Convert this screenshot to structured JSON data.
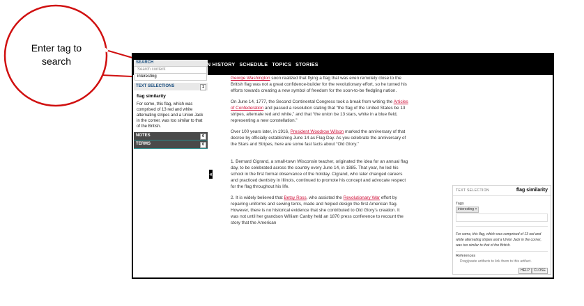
{
  "callout": {
    "text": "Enter tag to search"
  },
  "nav": {
    "items": [
      "N HISTORY",
      "SCHEDULE",
      "TOPICS",
      "STORIES"
    ]
  },
  "sidebar": {
    "search_header": "SEARCH",
    "search_placeholder": "Search content",
    "tag_value": "interesting",
    "text_selections_label": "TEXT SELECTIONS",
    "text_selections_count": "1",
    "selection": {
      "title": "flag similarity",
      "text": "For some, this flag, which was comprised of 13 red and white alternating stripes and a Union Jack in the corner, was too similar to that of the British."
    },
    "notes_label": "NOTES",
    "notes_count": "0",
    "terms_label": "TERMS",
    "terms_count": "0"
  },
  "collapse_icon": "«",
  "article": {
    "p1_link": "George Washington",
    "p1_rest": " soon realized that flying a flag that was even remotely close to the British flag was not a great confidence-builder for the revolutionary effort, so he turned his efforts towards creating a new symbol of freedom for the soon-to-be fledgling nation.",
    "p2_a": "On June 14, 1777, the Second Continental Congress took a break from writing the ",
    "p2_link": "Articles of Confederation",
    "p2_b": " and passed a resolution stating that “the flag of the United States be 13 stripes, alternate red and white,” and that “the union be 13 stars, white in a blue field, representing a new constellation.”",
    "p3_a": "Over 100 years later, in 1916, ",
    "p3_link": "President Woodrow Wilson",
    "p3_b": " marked the anniversary of that decree by officially establishing June 14 as Flag Day. As you celebrate the anniversary of the Stars and Stripes, here are some fast facts about “Old Glory.”",
    "p4": "1. Bernard Cigrand, a small-town Wisconsin teacher, originated the idea for an annual flag day, to be celebrated across the country every June 14, in 1885. That year, he led his school in the first formal observance of the holiday. Cigrand, who later changed careers and practiced dentistry in Illinois, continued to promote his concept and advocate respect for the flag throughout his life.",
    "p5_a": "2. It is widely believed that ",
    "p5_link1": "Betsy Ross",
    "p5_b": ", who assisted the ",
    "p5_link2": "Revolutionary War",
    "p5_c": " effort by repairing uniforms and sewing tents, made and helped design the first American flag. However, there is no historical evidence that she contributed to Old Glory’s creation. It was not until her grandson William Canby held an 1870 press conference to recount the story that the American"
  },
  "panel": {
    "kicker": "TEXT SELECTION",
    "title": "flag similarity",
    "tags_label": "Tags",
    "tag": "interesting ×",
    "note": "For some, this flag, which was comprised of 13 red and white alternating stripes and a Union Jack in the corner, was too similar to that of the British.",
    "references_label": "References",
    "references_hint": "Drag/paste artifacts to link them to this artifact.",
    "help_label": "HELP",
    "close_label": "CLOSE"
  }
}
